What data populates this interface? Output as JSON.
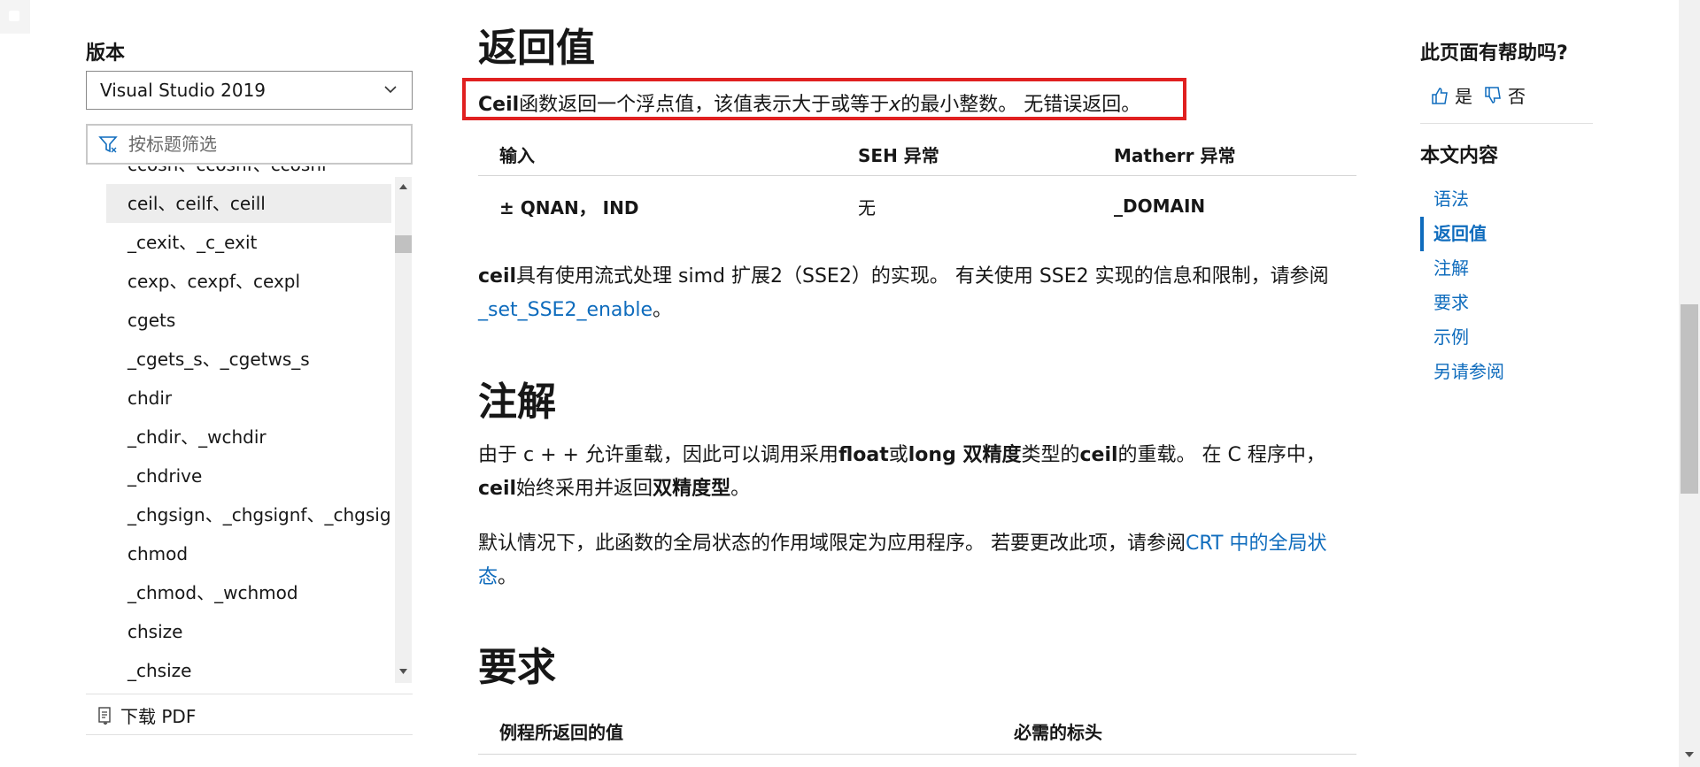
{
  "nav": {
    "version_label": "版本",
    "version_selected": "Visual Studio 2019",
    "filter_placeholder": "按标题筛选",
    "items": [
      "ccosh、ccoshf、ccoshl",
      "ceil、ceilf、ceill",
      "_cexit、_c_exit",
      "cexp、cexpf、cexpl",
      "cgets",
      "_cgets_s、_cgetws_s",
      "chdir",
      "_chdir、_wchdir",
      "_chdrive",
      "_chgsign、_chgsignf、_chgsignl",
      "chmod",
      "_chmod、_wchmod",
      "chsize",
      "_chsize"
    ],
    "active_item": "ceil、ceilf、ceill",
    "download_pdf": "下载 PDF"
  },
  "main": {
    "return_heading": "返回值",
    "return_para": {
      "fn": "Ceil",
      "text1": "函数返回一个浮点值，该值表示大于或等于",
      "var": "x",
      "text2": "的最小整数。 无错误返回。"
    },
    "table1": {
      "headers": [
        "输入",
        "SEH 异常",
        "Matherr 异常"
      ],
      "rows": [
        [
          "± QNAN， IND",
          "无",
          "_DOMAIN"
        ]
      ]
    },
    "sse_para": {
      "fn": "ceil",
      "text": "具有使用流式处理 simd 扩展2（SSE2）的实现。 有关使用 SSE2 实现的信息和限制，请参阅 ",
      "link": "_set_SSE2_enable",
      "end": "。"
    },
    "remarks_heading": "注解",
    "remarks_para1": {
      "t1": "由于 c + + 允许重载，因此可以调用采用",
      "b1": "float",
      "t2": "或",
      "b2": "long 双精度",
      "t3": "类型的",
      "b3": "ceil",
      "t4": "的重载。 在 C 程序中， ",
      "b4": "ceil",
      "t5": "始终采用并返回",
      "b5": "双精度型",
      "t6": "。"
    },
    "remarks_para2": {
      "text": "默认情况下，此函数的全局状态的作用域限定为应用程序。 若要更改此项，请参阅",
      "link": "CRT 中的全局状态",
      "end": "。"
    },
    "requirements_heading": "要求",
    "table2": {
      "headers": [
        "例程所返回的值",
        "必需的标头"
      ]
    }
  },
  "rail": {
    "help_title": "此页面有帮助吗?",
    "yes": "是",
    "no": "否",
    "toc_title": "本文内容",
    "toc": [
      "语法",
      "返回值",
      "注解",
      "要求",
      "示例",
      "另请参阅"
    ],
    "toc_current": "返回值"
  },
  "colors": {
    "link": "#0f6cbd",
    "highlight_border": "#e02020",
    "active_bg": "#ededed"
  }
}
